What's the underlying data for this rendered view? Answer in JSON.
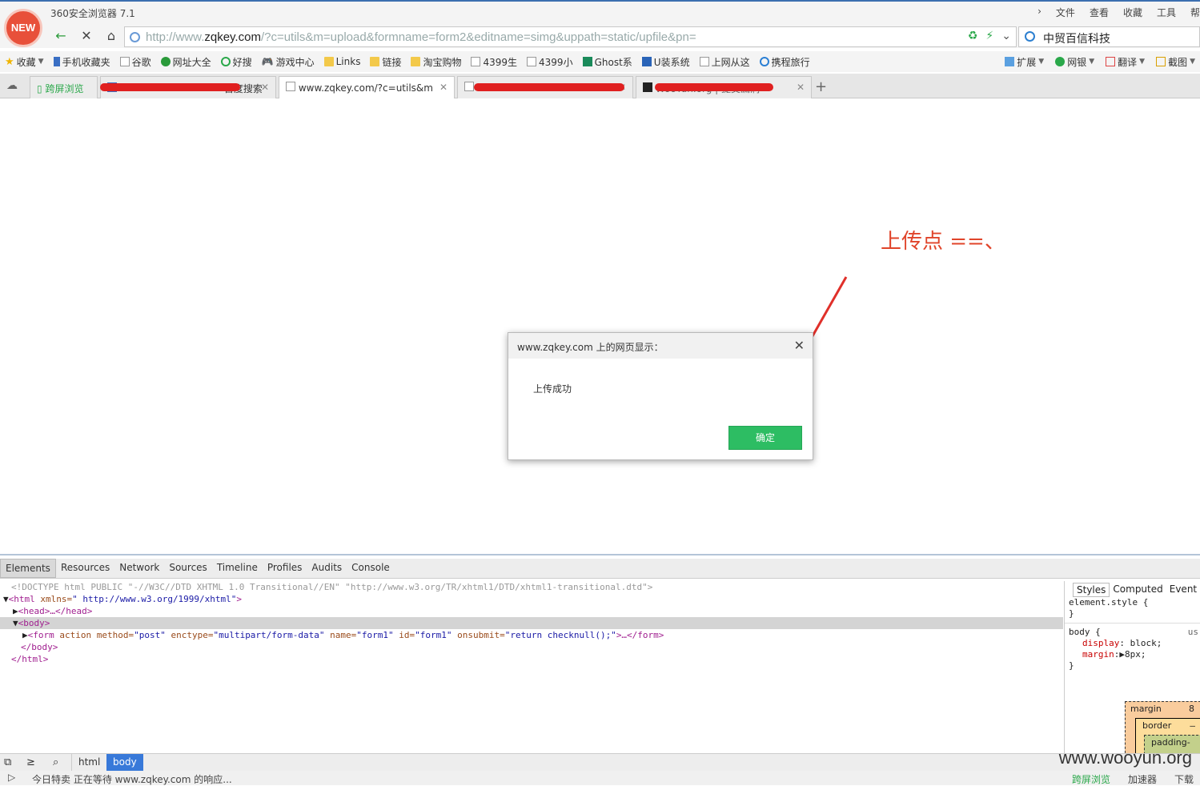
{
  "window": {
    "logo_text": "NEW",
    "app_title": "360安全浏览器 7.1",
    "menu": [
      "文件",
      "查看",
      "收藏",
      "工具",
      "帮"
    ]
  },
  "nav": {
    "url_prefix": "http://www.",
    "url_domain": "zqkey.com",
    "url_rest": "/?c=utils&m=upload&formname=form2&editname=simg&uppath=static/upfile&pn=",
    "search_value": "中贸百信科技"
  },
  "bookmarks": {
    "items": [
      "收藏",
      "手机收藏夹",
      "谷歌",
      "网址大全",
      "好搜",
      "游戏中心",
      "Links",
      "链接",
      "淘宝购物",
      "4399生",
      "4399小",
      "Ghost系",
      "U装系统",
      "上网从这",
      "携程旅行"
    ],
    "right_items": [
      "扩展",
      "网银",
      "翻译",
      "截图"
    ]
  },
  "tabs": {
    "first_label": "跨屏浏览",
    "tab2_label": "百度搜索",
    "active_label": "www.zqkey.com/?c=utils&m",
    "tab5_label": "WooYun.org | 提交漏洞"
  },
  "annotation": "上传点 ==、",
  "dialog": {
    "title": "www.zqkey.com 上的网页显示：",
    "message": "上传成功",
    "ok_label": "确定"
  },
  "devtools": {
    "tabs": [
      "Elements",
      "Resources",
      "Network",
      "Sources",
      "Timeline",
      "Profiles",
      "Audits",
      "Console"
    ],
    "styles_tabs": [
      "Styles",
      "Computed",
      "Event Lis"
    ],
    "dom": {
      "doctype": "<!DOCTYPE html PUBLIC \"-//W3C//DTD XHTML 1.0 Transitional//EN\" \"http://www.w3.org/TR/xhtml1/DTD/xhtml1-transitional.dtd\">",
      "html_open_tag": "<html",
      "html_attr": " xmlns=",
      "html_val": "\" http://www.w3.org/1999/xhtml\"",
      "html_close_bracket": ">",
      "head": "<head>…</head>",
      "body_open": "<body>",
      "form_tag": "<form",
      "form_attrs": " action method=",
      "form_method": "\"post\"",
      "form_enctype_attr": " enctype=",
      "form_enctype": "\"multipart/form-data\"",
      "form_name_attr": " name=",
      "form_name": "\"form1\"",
      "form_id_attr": " id=",
      "form_id": "\"form1\"",
      "form_onsubmit_attr": " onsubmit=",
      "form_onsubmit": "\"return checknull();\"",
      "form_close": ">…</form>",
      "body_close": "</body>",
      "html_close": "</html>"
    },
    "styles": {
      "element_style": "element.style {",
      "close_brace": "}",
      "body_rule": "body {",
      "ua_label": "us",
      "display_prop": "display",
      "display_val": ": block;",
      "margin_prop": "margin",
      "margin_val": ":▶8px;"
    },
    "boxmodel": {
      "margin_label": "margin",
      "margin_value": "8",
      "border_label": "border",
      "border_value": "–",
      "padding_label": "padding-"
    },
    "breadcrumbs": [
      "html",
      "body"
    ]
  },
  "watermark": "www.wooyun.org",
  "status": {
    "left": "今日特卖   正在等待 www.zqkey.com 的响应...",
    "right": [
      "跨屏浏览",
      "加速器",
      "下载"
    ]
  }
}
